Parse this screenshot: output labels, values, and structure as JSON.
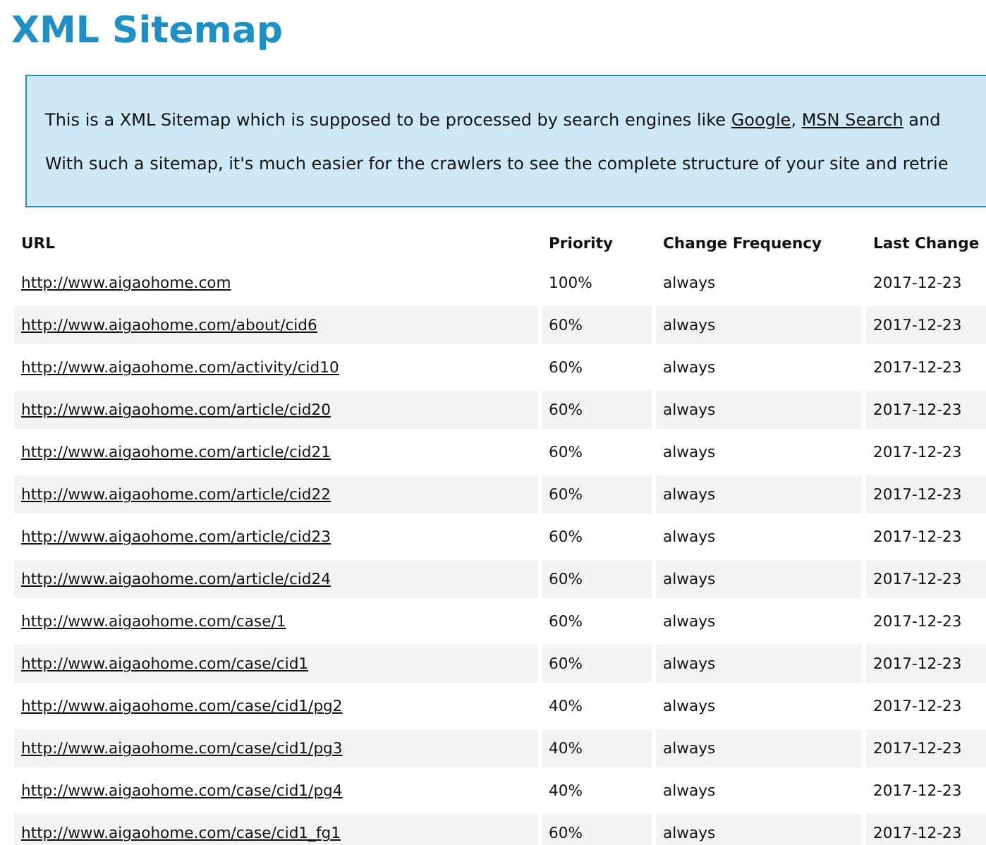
{
  "title": "XML Sitemap",
  "intro": [
    [
      {
        "kind": "text",
        "text": "This is a XML Sitemap which is supposed to be processed by search engines like "
      },
      {
        "kind": "link",
        "text": "Google"
      },
      {
        "kind": "text",
        "text": ", "
      },
      {
        "kind": "link",
        "text": "MSN Search"
      },
      {
        "kind": "text",
        "text": " and"
      }
    ],
    [
      {
        "kind": "text",
        "text": "With such a sitemap, it's much easier for the crawlers to see the complete structure of your site and retrie"
      }
    ]
  ],
  "table": {
    "columns": [
      "URL",
      "Priority",
      "Change Frequency",
      "Last Change"
    ],
    "rows": [
      {
        "url": "http://www.aigaohome.com",
        "priority": "100%",
        "frequency": "always",
        "last_change": "2017-12-23"
      },
      {
        "url": "http://www.aigaohome.com/about/cid6",
        "priority": "60%",
        "frequency": "always",
        "last_change": "2017-12-23"
      },
      {
        "url": "http://www.aigaohome.com/activity/cid10",
        "priority": "60%",
        "frequency": "always",
        "last_change": "2017-12-23"
      },
      {
        "url": "http://www.aigaohome.com/article/cid20",
        "priority": "60%",
        "frequency": "always",
        "last_change": "2017-12-23"
      },
      {
        "url": "http://www.aigaohome.com/article/cid21",
        "priority": "60%",
        "frequency": "always",
        "last_change": "2017-12-23"
      },
      {
        "url": "http://www.aigaohome.com/article/cid22",
        "priority": "60%",
        "frequency": "always",
        "last_change": "2017-12-23"
      },
      {
        "url": "http://www.aigaohome.com/article/cid23",
        "priority": "60%",
        "frequency": "always",
        "last_change": "2017-12-23"
      },
      {
        "url": "http://www.aigaohome.com/article/cid24",
        "priority": "60%",
        "frequency": "always",
        "last_change": "2017-12-23"
      },
      {
        "url": "http://www.aigaohome.com/case/1",
        "priority": "60%",
        "frequency": "always",
        "last_change": "2017-12-23"
      },
      {
        "url": "http://www.aigaohome.com/case/cid1",
        "priority": "60%",
        "frequency": "always",
        "last_change": "2017-12-23"
      },
      {
        "url": "http://www.aigaohome.com/case/cid1/pg2",
        "priority": "40%",
        "frequency": "always",
        "last_change": "2017-12-23"
      },
      {
        "url": "http://www.aigaohome.com/case/cid1/pg3",
        "priority": "40%",
        "frequency": "always",
        "last_change": "2017-12-23"
      },
      {
        "url": "http://www.aigaohome.com/case/cid1/pg4",
        "priority": "40%",
        "frequency": "always",
        "last_change": "2017-12-23"
      },
      {
        "url": "http://www.aigaohome.com/case/cid1_fg1",
        "priority": "60%",
        "frequency": "always",
        "last_change": "2017-12-23"
      }
    ]
  }
}
